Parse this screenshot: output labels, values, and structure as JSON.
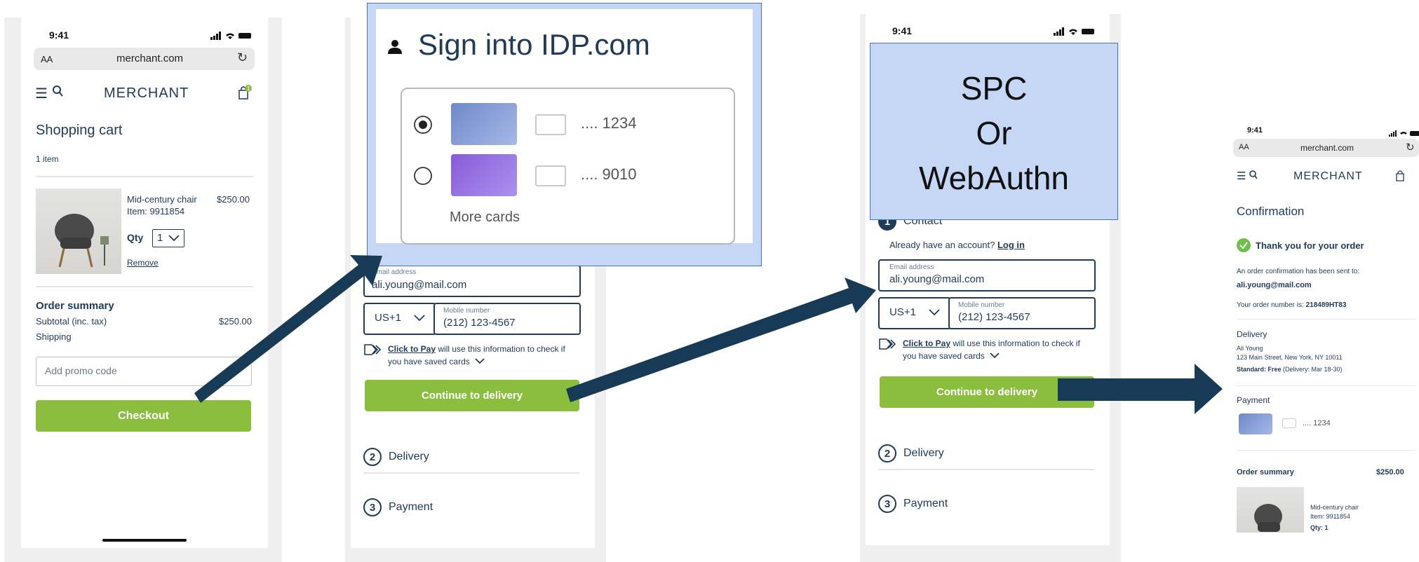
{
  "status_time": "9:41",
  "browser": {
    "text_size": "AA",
    "url": "merchant.com"
  },
  "brand": "MERCHANT",
  "cart_badge": "1",
  "screen1": {
    "title": "Shopping cart",
    "item_count": "1 item",
    "product": {
      "name": "Mid-century chair",
      "item": "Item: 9911854",
      "price": "$250.00"
    },
    "qty_label": "Qty",
    "qty_value": "1",
    "remove_label": "Remove",
    "summary_title": "Order summary",
    "subtotal_label": "Subtotal (inc. tax)",
    "subtotal_value": "$250.00",
    "shipping_label": "Shipping",
    "promo_placeholder": "Add promo code",
    "checkout_label": "Checkout"
  },
  "idp_popup": {
    "title": "Sign into IDP.com",
    "cards": [
      {
        "mask": ".... 1234",
        "selected": true
      },
      {
        "mask": ".... 9010",
        "selected": false
      }
    ],
    "more_cards": "More cards"
  },
  "checkout": {
    "contact_label": "Contact",
    "account_prompt": "Already have an account?",
    "login_label": "Log in",
    "email_label": "Email address",
    "email_value": "ali.young@mail.com",
    "country_code": "US+1",
    "mobile_label": "Mobile number",
    "mobile_value": "(212) 123-4567",
    "ctp_name": "Click to Pay",
    "ctp_text": " will use this information to check if",
    "ctp_text2": "you have saved cards",
    "continue_label": "Continue to delivery",
    "step2": "Delivery",
    "step3": "Payment",
    "step1_num": "1",
    "step2_num": "2",
    "step3_num": "3"
  },
  "spc_box": {
    "line1": "SPC",
    "line2": "Or",
    "line3": "WebAuthn"
  },
  "confirmation": {
    "title": "Confirmation",
    "thanks": "Thank you for your order",
    "sent_to": "An order confirmation has been sent to:",
    "email": "ali.young@mail.com",
    "order_num_label": "Your order number is:",
    "order_num": "218489HT83",
    "delivery_title": "Delivery",
    "name": "Ali Young",
    "address": "123 Main Street, New York, NY 10011",
    "standard_label": "Standard: Free",
    "delivery_dates": " (Delivery: Mar 18-30)",
    "payment_title": "Payment",
    "card_mask": ".... 1234",
    "summary_title": "Order summary",
    "summary_total": "$250.00",
    "product_name": "Mid-century chair",
    "product_item": "Item: 9911854",
    "product_qty": "Qty: 1"
  },
  "colors": {
    "navy": "#1f3b57",
    "green": "#8bbd3f",
    "arrow": "#173a57",
    "spc_fill": "#c5d7f4",
    "spc_border": "#4472c4"
  }
}
